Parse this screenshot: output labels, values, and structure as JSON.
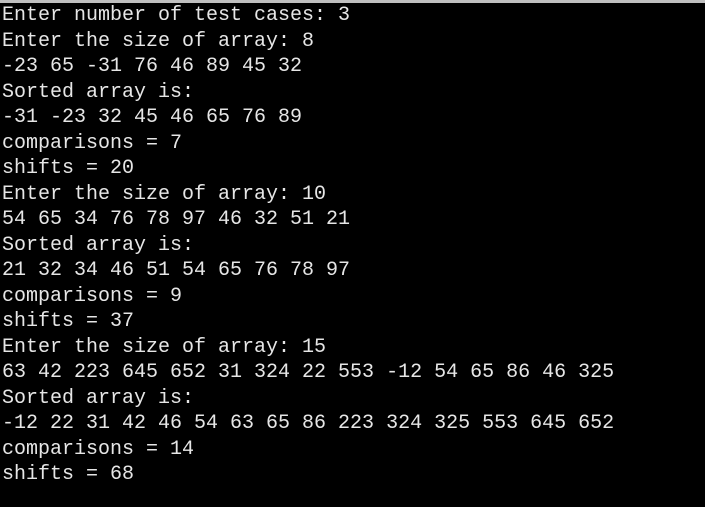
{
  "terminal": {
    "lines": [
      "Enter number of test cases: 3",
      "Enter the size of array: 8",
      "-23 65 -31 76 46 89 45 32",
      "Sorted array is:",
      "-31 -23 32 45 46 65 76 89",
      "comparisons = 7",
      "shifts = 20",
      "Enter the size of array: 10",
      "54 65 34 76 78 97 46 32 51 21",
      "Sorted array is:",
      "21 32 34 46 51 54 65 76 78 97",
      "comparisons = 9",
      "shifts = 37",
      "Enter the size of array: 15",
      "63 42 223 645 652 31 324 22 553 -12 54 65 86 46 325",
      "Sorted array is:",
      "-12 22 31 42 46 54 63 65 86 223 324 325 553 645 652",
      "comparisons = 14",
      "shifts = 68"
    ]
  },
  "colors": {
    "background": "#000000",
    "text": "#e6e6e6",
    "window_border": "#bfbfbf"
  }
}
